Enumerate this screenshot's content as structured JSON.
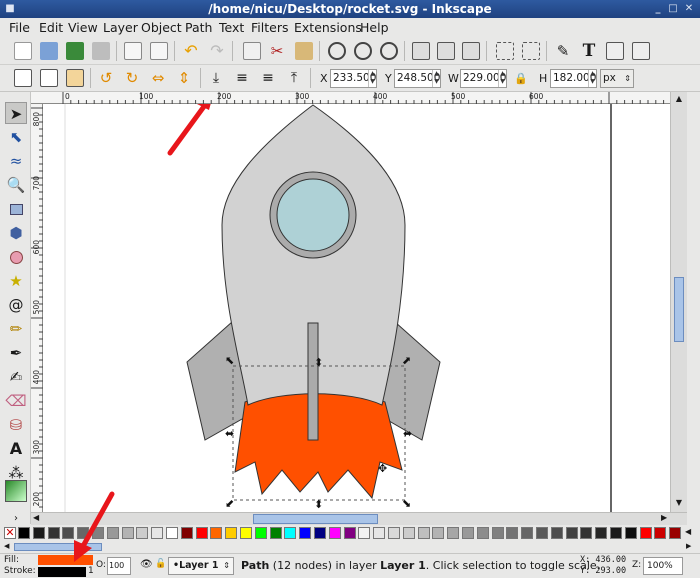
{
  "window": {
    "title": "/home/nicu/Desktop/rocket.svg - Inkscape"
  },
  "menu": {
    "items": [
      {
        "label": "File"
      },
      {
        "label": "Edit"
      },
      {
        "label": "View"
      },
      {
        "label": "Layer"
      },
      {
        "label": "Object"
      },
      {
        "label": "Path"
      },
      {
        "label": "Text"
      },
      {
        "label": "Filters"
      },
      {
        "label": "Extensions"
      },
      {
        "label": "Help"
      }
    ]
  },
  "commands_bar": {
    "icons": [
      "new-document-icon",
      "open-icon",
      "save-icon",
      "print-icon",
      "import-icon",
      "export-icon",
      "undo-icon",
      "redo-icon",
      "copy-icon",
      "cut-icon",
      "paste-icon",
      "zoom-selection-icon",
      "zoom-drawing-icon",
      "zoom-page-icon",
      "duplicate-icon",
      "clone-icon",
      "unlink-clone-icon",
      "group-icon",
      "ungroup-icon",
      "fill-stroke-icon",
      "text-font-icon",
      "xml-editor-icon",
      "align-icon"
    ]
  },
  "controls_bar": {
    "x_label": "X",
    "x_value": "233.500",
    "y_label": "Y",
    "y_value": "248.500",
    "w_label": "W",
    "w_value": "229.000",
    "h_label": "H",
    "h_value": "182.000",
    "unit": "px"
  },
  "rulers": {
    "horizontal_labels": [
      "0",
      "100",
      "200",
      "300",
      "400",
      "500",
      "600"
    ],
    "vertical_labels": [
      "800",
      "700",
      "600",
      "500",
      "400",
      "300",
      "200"
    ]
  },
  "tools": [
    "selector-icon",
    "node-icon",
    "tweak-icon",
    "zoom-icon",
    "rectangle-icon",
    "3d-box-icon",
    "ellipse-icon",
    "star-icon",
    "spiral-icon",
    "pencil-icon",
    "pen-icon",
    "calligraphy-icon",
    "eraser-icon",
    "bucket-icon",
    "text-icon",
    "spray-icon",
    "connector-icon",
    "gradient-icon",
    "more-icon"
  ],
  "colors": {
    "rocket_body": "#d2d2d2",
    "window_ring": "#ababab",
    "window_glass": "#aed1d6",
    "fins": "#b0b0b0",
    "flame": "#ff5000",
    "arrow": "#e8161b",
    "fill_indicator": "#ff5000",
    "stroke_indicator": "#000000"
  },
  "palette": {
    "swatches": [
      "#000000",
      "#1a1a1a",
      "#333333",
      "#4d4d4d",
      "#666666",
      "#808080",
      "#999999",
      "#b3b3b3",
      "#cccccc",
      "#e6e6e6",
      "#ffffff",
      "#800000",
      "#ff0000",
      "#ff6600",
      "#ffcc00",
      "#ffff00",
      "#00ff00",
      "#008000",
      "#00ffff",
      "#0000ff",
      "#000080",
      "#ff00ff",
      "#800080",
      "#f2f2f2",
      "#e6e6e6",
      "#d9d9d9",
      "#cccccc",
      "#bfbfbf",
      "#b3b3b3",
      "#a6a6a6",
      "#999999",
      "#8c8c8c",
      "#808080",
      "#737373",
      "#666666",
      "#595959",
      "#4d4d4d",
      "#404040",
      "#333333",
      "#262626",
      "#1a1a1a",
      "#0d0d0d",
      "#ff0000",
      "#cc0000",
      "#990000"
    ]
  },
  "status": {
    "fill_label": "Fill:",
    "stroke_label": "Stroke:",
    "stroke_width": "1",
    "opacity_label": "O:",
    "opacity_value": "100",
    "layer_name": "•Layer 1",
    "message_bold_path": "Path",
    "message_rest_1": " (12 nodes) in layer ",
    "message_bold_layer": "Layer 1",
    "message_rest_2": ". Click selection to toggle scale.",
    "x_coord": "X: 436.00",
    "y_coord": "Y: 293.00",
    "zoom_label": "Z:",
    "zoom_value": "100%"
  }
}
